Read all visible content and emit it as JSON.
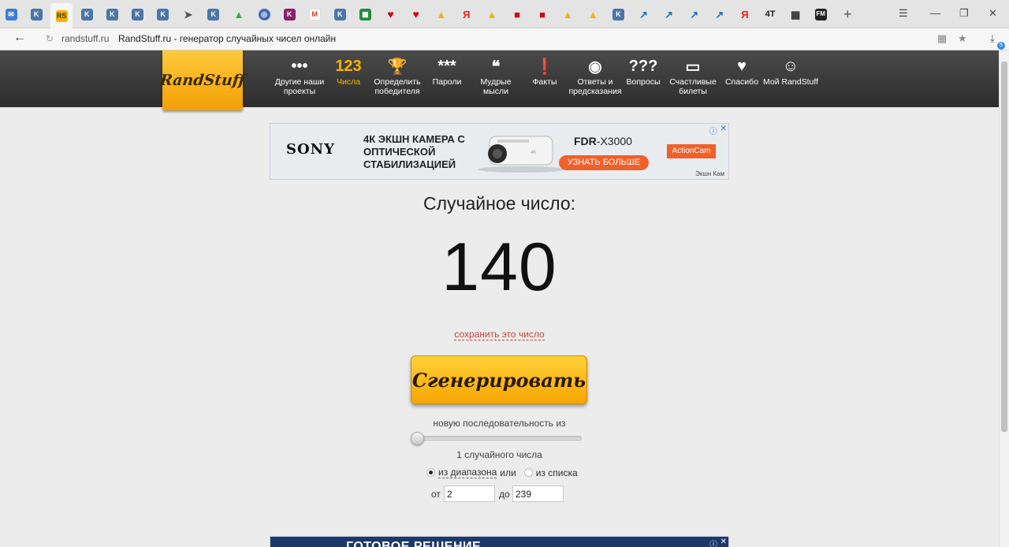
{
  "browser": {
    "tabs": [
      {
        "icon": "message-icon",
        "glyph": "✉"
      },
      {
        "icon": "vk-icon",
        "glyph": "K"
      },
      {
        "icon": "randstuff-icon",
        "glyph": "RS",
        "active": true
      },
      {
        "icon": "vk-icon",
        "glyph": "K"
      },
      {
        "icon": "vk-icon",
        "glyph": "K"
      },
      {
        "icon": "vk-icon",
        "glyph": "K"
      },
      {
        "icon": "vk-icon",
        "glyph": "K"
      },
      {
        "icon": "telegram-icon",
        "glyph": "➤"
      },
      {
        "icon": "vk-icon",
        "glyph": "K"
      },
      {
        "icon": "drive-icon",
        "glyph": "▲"
      },
      {
        "icon": "circle-icon",
        "glyph": "◎"
      },
      {
        "icon": "k-icon",
        "glyph": "K"
      },
      {
        "icon": "gmail-icon",
        "glyph": "M"
      },
      {
        "icon": "vk-icon",
        "glyph": "K"
      },
      {
        "icon": "sheets-icon",
        "glyph": "▦"
      },
      {
        "icon": "heart-icon",
        "glyph": "♥"
      },
      {
        "icon": "heart-icon",
        "glyph": "♥"
      },
      {
        "icon": "yellow-icon",
        "glyph": "▲"
      },
      {
        "icon": "yandex-icon",
        "glyph": "Я"
      },
      {
        "icon": "yellow-icon",
        "glyph": "▲"
      },
      {
        "icon": "bookmark-icon",
        "glyph": "■"
      },
      {
        "icon": "bookmark-icon",
        "glyph": "■"
      },
      {
        "icon": "yellow-icon",
        "glyph": "▲"
      },
      {
        "icon": "yellow-icon",
        "glyph": "▲"
      },
      {
        "icon": "vk-icon",
        "glyph": "K"
      },
      {
        "icon": "bird-icon",
        "glyph": "↗"
      },
      {
        "icon": "bird-icon",
        "glyph": "↗"
      },
      {
        "icon": "bird-icon",
        "glyph": "↗"
      },
      {
        "icon": "bird-icon",
        "glyph": "↗"
      },
      {
        "icon": "yandex-icon",
        "glyph": "Я"
      },
      {
        "icon": "text-4t-icon",
        "glyph": "4T"
      },
      {
        "icon": "qr-icon",
        "glyph": "▦"
      },
      {
        "icon": "fm-icon",
        "glyph": "FM"
      }
    ],
    "url_domain": "randstuff.ru",
    "page_title": "RandStuff.ru - генератор случайных чисел онлайн",
    "download_count": "5"
  },
  "site": {
    "logo": "RandStuff",
    "nav": [
      {
        "icon": "more-icon",
        "glyph": "•••",
        "label": "Другие наши проекты"
      },
      {
        "icon": "numbers-icon",
        "glyph": "123",
        "label": "Числа",
        "active": true
      },
      {
        "icon": "trophy-icon",
        "glyph": "🏆",
        "label": "Определить победителя"
      },
      {
        "icon": "password-icon",
        "glyph": "***",
        "label": "Пароли"
      },
      {
        "icon": "quote-icon",
        "glyph": "❝",
        "label": "Мудрые мысли"
      },
      {
        "icon": "fact-icon",
        "glyph": "❗",
        "label": "Факты"
      },
      {
        "icon": "magic-ball-icon",
        "glyph": "◉",
        "label": "Ответы и предсказания"
      },
      {
        "icon": "questions-icon",
        "glyph": "???",
        "label": "Вопросы"
      },
      {
        "icon": "ticket-icon",
        "glyph": "▭",
        "label": "Счастливые билеты"
      },
      {
        "icon": "heart-icon",
        "glyph": "♥",
        "label": "Спасибо"
      },
      {
        "icon": "user-icon",
        "glyph": "☺",
        "label": "Мой RandStuff"
      }
    ]
  },
  "ad_top": {
    "brand": "SONY",
    "headline": "4К ЭКШН КАМЕРА С ОПТИЧЕСКОЙ СТАБИЛИЗАЦИЕЙ",
    "model_bold": "FDR",
    "model_rest": "-X3000",
    "cta": "УЗНАТЬ БОЛЬШЕ",
    "tag": "ActionCam",
    "source": "Экшн Кам"
  },
  "ad_bottom": {
    "headline": "ГОТОВОЕ РЕШЕНИЕ"
  },
  "generator": {
    "result_label": "Случайное число:",
    "result_value": "140",
    "save_link": "сохранить это число",
    "generate_button": "Сгенерировать",
    "sequence_label": "новую последовательность из",
    "count_label": "1 случайного числа",
    "count_value": 1,
    "mode_range": "из диапазона",
    "mode_or": "или",
    "mode_list": "из списка",
    "from_label": "от",
    "from_value": "2",
    "to_label": "до",
    "to_value": "239"
  }
}
